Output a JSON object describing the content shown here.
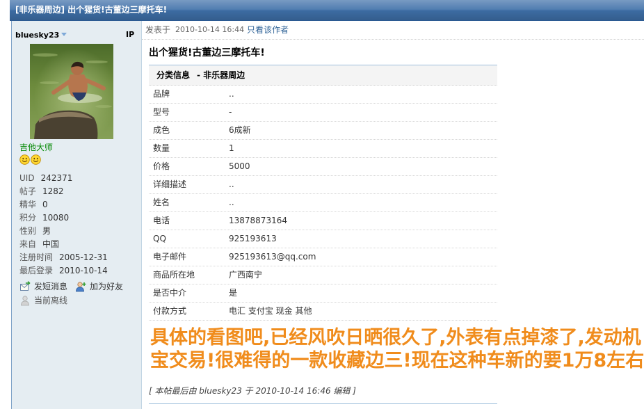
{
  "header": {
    "title": "[非乐器周边] 出个猩货!古董边三摩托车!"
  },
  "author": {
    "username": "bluesky23",
    "ip_label": "IP",
    "group": "吉他大师",
    "stats": [
      {
        "label": "UID",
        "value": "242371"
      },
      {
        "label": "帖子",
        "value": "1282"
      },
      {
        "label": "精华",
        "value": "0"
      },
      {
        "label": "积分",
        "value": "10080"
      },
      {
        "label": "性别",
        "value": "男"
      },
      {
        "label": "来自",
        "value": "中国"
      },
      {
        "label": "注册时间",
        "value": "2005-12-31"
      },
      {
        "label": "最后登录",
        "value": "2010-10-14"
      }
    ],
    "actions": {
      "send_message": "发短消息",
      "add_friend": "加为好友"
    },
    "online_status": "当前离线"
  },
  "post": {
    "posted_label": "发表于",
    "posted_time": "2010-10-14 16:44",
    "only_author_link": "只看该作者",
    "title": "出个猩货!古董边三摩托车!",
    "info_table": {
      "heading": "分类信息",
      "category": "- 非乐器周边",
      "rows": [
        {
          "label": "品牌",
          "value": ".."
        },
        {
          "label": "型号",
          "value": "-"
        },
        {
          "label": "成色",
          "value": "6成新"
        },
        {
          "label": "数量",
          "value": "1"
        },
        {
          "label": "价格",
          "value": "5000"
        },
        {
          "label": "详细描述",
          "value": ".."
        },
        {
          "label": "姓名",
          "value": ".."
        },
        {
          "label": "电话",
          "value": "13878873164"
        },
        {
          "label": "QQ",
          "value": "925193613"
        },
        {
          "label": "电子邮件",
          "value": "925193613@qq.com"
        },
        {
          "label": "商品所在地",
          "value": "广西南宁"
        },
        {
          "label": "是否中介",
          "value": "是"
        },
        {
          "label": "付款方式",
          "value": "电汇 支付宝 现金 其他"
        }
      ]
    },
    "body_lines": [
      "具体的看图吧,已经风吹日晒很久了,外表有点掉漆了,发动机",
      "宝交易!很难得的一款收藏边三!现在这种车新的要1万8左右"
    ],
    "edit_note": "[ 本帖最后由 bluesky23 于 2010-10-14 16:46 编辑 ]"
  },
  "icons": {
    "username_menu": "chevron-down-icon",
    "rank": "smiley-icon",
    "send_message": "envelope-icon",
    "add_friend": "add-friend-icon",
    "offline": "offline-user-icon"
  },
  "colors": {
    "header": "#3e6fa8",
    "sidebar": "#e5edf2",
    "link": "#336699",
    "group": "#008800",
    "highlight": "#f08c1c"
  }
}
